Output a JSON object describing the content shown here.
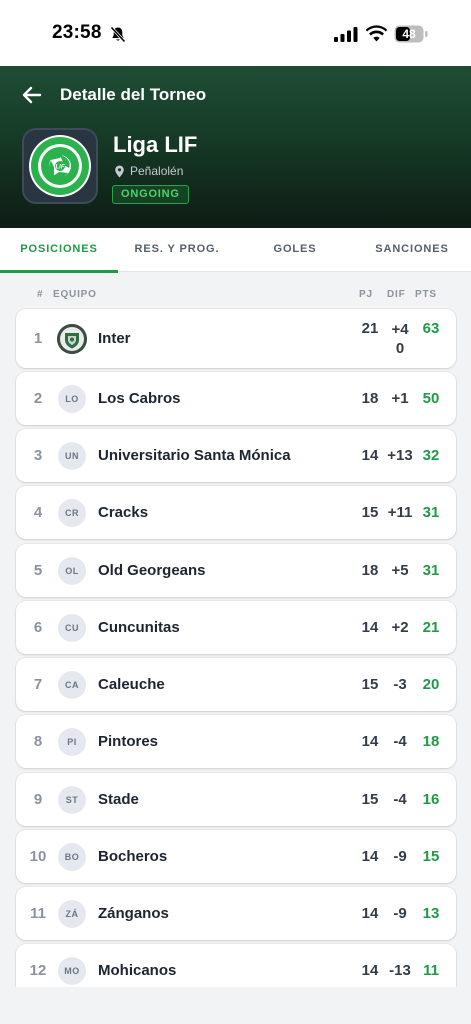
{
  "status_bar": {
    "time": "23:58",
    "battery": "48"
  },
  "header": {
    "back_icon": "arrow-left-icon",
    "title": "Detalle del Torneo"
  },
  "league": {
    "name": "Liga LIF",
    "location": "Peñalolén",
    "status": "ONGOING",
    "logo_icon": "league-logo-icon"
  },
  "tabs": [
    {
      "label": "POSICIONES",
      "active": true
    },
    {
      "label": "RES. Y PROG.",
      "active": false
    },
    {
      "label": "GOLES",
      "active": false
    },
    {
      "label": "SANCIONES",
      "active": false
    }
  ],
  "table_headers": {
    "pos": "#",
    "team": "EQUIPO",
    "pj": "PJ",
    "dif": "DIF",
    "pts": "PTS"
  },
  "standings": [
    {
      "pos": "1",
      "initials": "",
      "team": "Inter",
      "pj": "21",
      "dif": "+40",
      "pts": "63",
      "crest": true
    },
    {
      "pos": "2",
      "initials": "LO",
      "team": "Los Cabros",
      "pj": "18",
      "dif": "+1",
      "pts": "50"
    },
    {
      "pos": "3",
      "initials": "UN",
      "team": "Universitario Santa Mónica",
      "pj": "14",
      "dif": "+13",
      "pts": "32"
    },
    {
      "pos": "4",
      "initials": "CR",
      "team": "Cracks",
      "pj": "15",
      "dif": "+11",
      "pts": "31"
    },
    {
      "pos": "5",
      "initials": "OL",
      "team": "Old Georgeans",
      "pj": "18",
      "dif": "+5",
      "pts": "31"
    },
    {
      "pos": "6",
      "initials": "CU",
      "team": "Cuncunitas",
      "pj": "14",
      "dif": "+2",
      "pts": "21"
    },
    {
      "pos": "7",
      "initials": "CA",
      "team": "Caleuche",
      "pj": "15",
      "dif": "-3",
      "pts": "20"
    },
    {
      "pos": "8",
      "initials": "PI",
      "team": "Pintores",
      "pj": "14",
      "dif": "-4",
      "pts": "18"
    },
    {
      "pos": "9",
      "initials": "ST",
      "team": "Stade",
      "pj": "15",
      "dif": "-4",
      "pts": "16"
    },
    {
      "pos": "10",
      "initials": "BO",
      "team": "Bocheros",
      "pj": "14",
      "dif": "-9",
      "pts": "15"
    },
    {
      "pos": "11",
      "initials": "ZÁ",
      "team": "Zánganos",
      "pj": "14",
      "dif": "-9",
      "pts": "13"
    },
    {
      "pos": "12",
      "initials": "MO",
      "team": "Mohicanos",
      "pj": "14",
      "dif": "-13",
      "pts": "11"
    }
  ],
  "colors": {
    "accent": "#1f9a46",
    "header_dark": "#163a26"
  }
}
